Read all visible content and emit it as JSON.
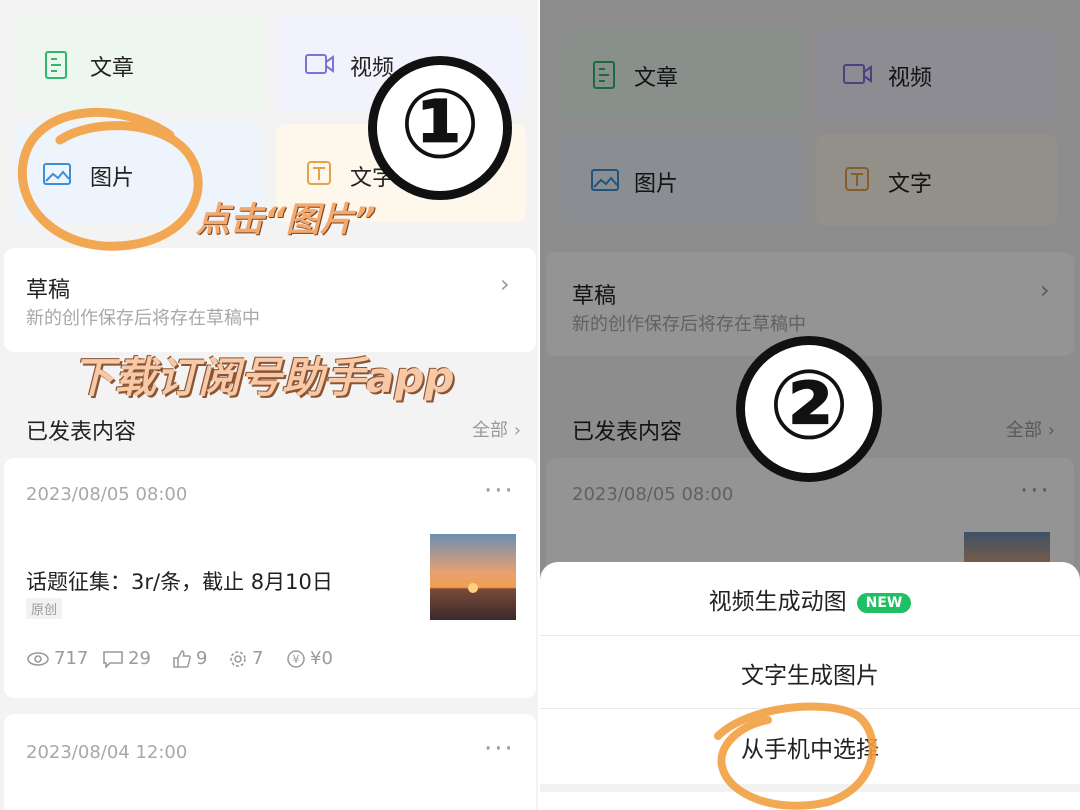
{
  "left": {
    "tiles": [
      {
        "label": "文章"
      },
      {
        "label": "视频"
      },
      {
        "label": "图片"
      },
      {
        "label": "文字"
      }
    ],
    "drafts": {
      "title": "草稿",
      "subtitle": "新的创作保存后将存在草稿中"
    },
    "published": {
      "title": "已发表内容",
      "all": "全部"
    },
    "post1": {
      "date": "2023/08/05 08:00",
      "title": "话题征集：3r/条，截止 8月10日",
      "tag": "原创",
      "stats": {
        "views": "717",
        "comments": "29",
        "likes": "9",
        "shares": "7",
        "earnings": "¥0"
      }
    },
    "post2": {
      "date": "2023/08/04 12:00"
    }
  },
  "right": {
    "tiles": [
      {
        "label": "文章"
      },
      {
        "label": "视频"
      },
      {
        "label": "图片"
      },
      {
        "label": "文字"
      }
    ],
    "drafts": {
      "title": "草稿",
      "subtitle": "新的创作保存后将存在草稿中"
    },
    "published": {
      "title": "已发表内容",
      "all": "全部"
    },
    "post1": {
      "date": "2023/08/05 08:00"
    },
    "sheet": {
      "items": [
        {
          "label": "视频生成动图",
          "badge": "NEW"
        },
        {
          "label": "文字生成图片"
        },
        {
          "label": "从手机中选择"
        }
      ]
    }
  },
  "annotations": {
    "step1": "①",
    "step2": "②",
    "click_hint": "点击“图片”",
    "download_hint": "下载订阅号助手app"
  },
  "colors": {
    "accent_orange": "#f2a36b",
    "new_badge": "#1fbf63"
  }
}
